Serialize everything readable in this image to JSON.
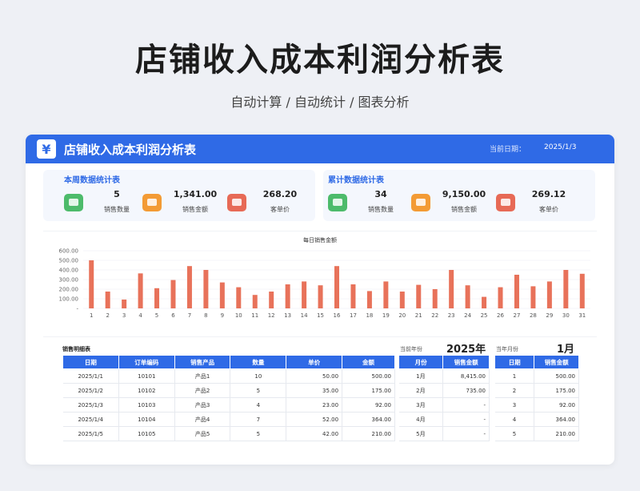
{
  "page": {
    "title": "店铺收入成本利润分析表",
    "subtitle": "自动计算 / 自动统计 / 图表分析"
  },
  "card": {
    "logo": "¥",
    "title": "店铺收入成本利润分析表",
    "date_label": "当前日期：",
    "date_value": "2025/1/3"
  },
  "weekly": {
    "title": "本周数据统计表",
    "stats": [
      {
        "value": "5",
        "label": "销售数量",
        "icon": "product-icon",
        "color": "#4dbb6b"
      },
      {
        "value": "1,341.00",
        "label": "销售金额",
        "icon": "money-icon",
        "color": "#f39b35"
      },
      {
        "value": "268.20",
        "label": "客单价",
        "icon": "wallet-icon",
        "color": "#e76a56"
      }
    ]
  },
  "cumulative": {
    "title": "累计数据统计表",
    "stats": [
      {
        "value": "34",
        "label": "销售数量",
        "icon": "product-icon",
        "color": "#4dbb6b"
      },
      {
        "value": "9,150.00",
        "label": "销售金额",
        "icon": "money-icon",
        "color": "#f39b35"
      },
      {
        "value": "269.12",
        "label": "客单价",
        "icon": "wallet-icon",
        "color": "#e76a56"
      }
    ]
  },
  "chart_data": {
    "type": "bar",
    "title": "每日销售金额",
    "categories": [
      "1",
      "2",
      "3",
      "4",
      "5",
      "6",
      "7",
      "8",
      "9",
      "10",
      "11",
      "12",
      "13",
      "14",
      "15",
      "16",
      "17",
      "18",
      "19",
      "20",
      "21",
      "22",
      "23",
      "24",
      "25",
      "26",
      "27",
      "28",
      "29",
      "30",
      "31"
    ],
    "values": [
      500,
      175,
      92,
      364,
      210,
      295,
      440,
      400,
      270,
      220,
      140,
      175,
      250,
      280,
      240,
      440,
      250,
      180,
      280,
      175,
      245,
      200,
      400,
      240,
      120,
      220,
      350,
      230,
      280,
      400,
      360
    ],
    "ylim": [
      0,
      600
    ],
    "yticks": [
      "600.00",
      "500.00",
      "400.00",
      "300.00",
      "200.00",
      "100.00",
      "-"
    ],
    "grid": true,
    "legend": "none",
    "color": "#e8725a"
  },
  "detail": {
    "title": "销售明细表",
    "columns": [
      "日期",
      "订单编码",
      "销售产品",
      "数量",
      "单价",
      "金额"
    ],
    "rows": [
      [
        "2025/1/1",
        "10101",
        "产品1",
        "10",
        "50.00",
        "500.00"
      ],
      [
        "2025/1/2",
        "10102",
        "产品2",
        "5",
        "35.00",
        "175.00"
      ],
      [
        "2025/1/3",
        "10103",
        "产品3",
        "4",
        "23.00",
        "92.00"
      ],
      [
        "2025/1/4",
        "10104",
        "产品4",
        "7",
        "52.00",
        "364.00"
      ],
      [
        "2025/1/5",
        "10105",
        "产品5",
        "5",
        "42.00",
        "210.00"
      ]
    ]
  },
  "year_summary": {
    "label": "当前年份",
    "value": "2025年",
    "columns": [
      "月份",
      "销售金额"
    ],
    "rows": [
      [
        "1月",
        "8,415.00"
      ],
      [
        "2月",
        "735.00"
      ],
      [
        "3月",
        "-"
      ],
      [
        "4月",
        "-"
      ],
      [
        "5月",
        "-"
      ]
    ]
  },
  "month_summary": {
    "label": "当年月份",
    "value": "1月",
    "columns": [
      "日期",
      "销售金额"
    ],
    "rows": [
      [
        "1",
        "500.00"
      ],
      [
        "2",
        "175.00"
      ],
      [
        "3",
        "92.00"
      ],
      [
        "4",
        "364.00"
      ],
      [
        "5",
        "210.00"
      ]
    ]
  }
}
